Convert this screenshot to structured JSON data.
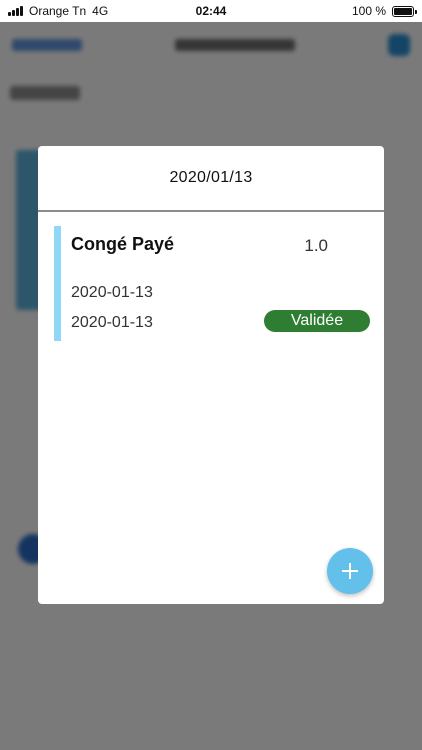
{
  "status_bar": {
    "carrier": "Orange Tn",
    "network": "4G",
    "time": "02:44",
    "battery": "100 %"
  },
  "modal": {
    "date": "2020/01/13",
    "entries": [
      {
        "type": "Congé Payé",
        "days": "1.0",
        "start_date": "2020-01-13",
        "end_date": "2020-01-13",
        "status": "Validée"
      }
    ],
    "add_icon": "plus-icon"
  },
  "colors": {
    "accent_bar": "#8fd6f7",
    "status_validated": "#2e7d32",
    "fab": "#62c0ea"
  }
}
